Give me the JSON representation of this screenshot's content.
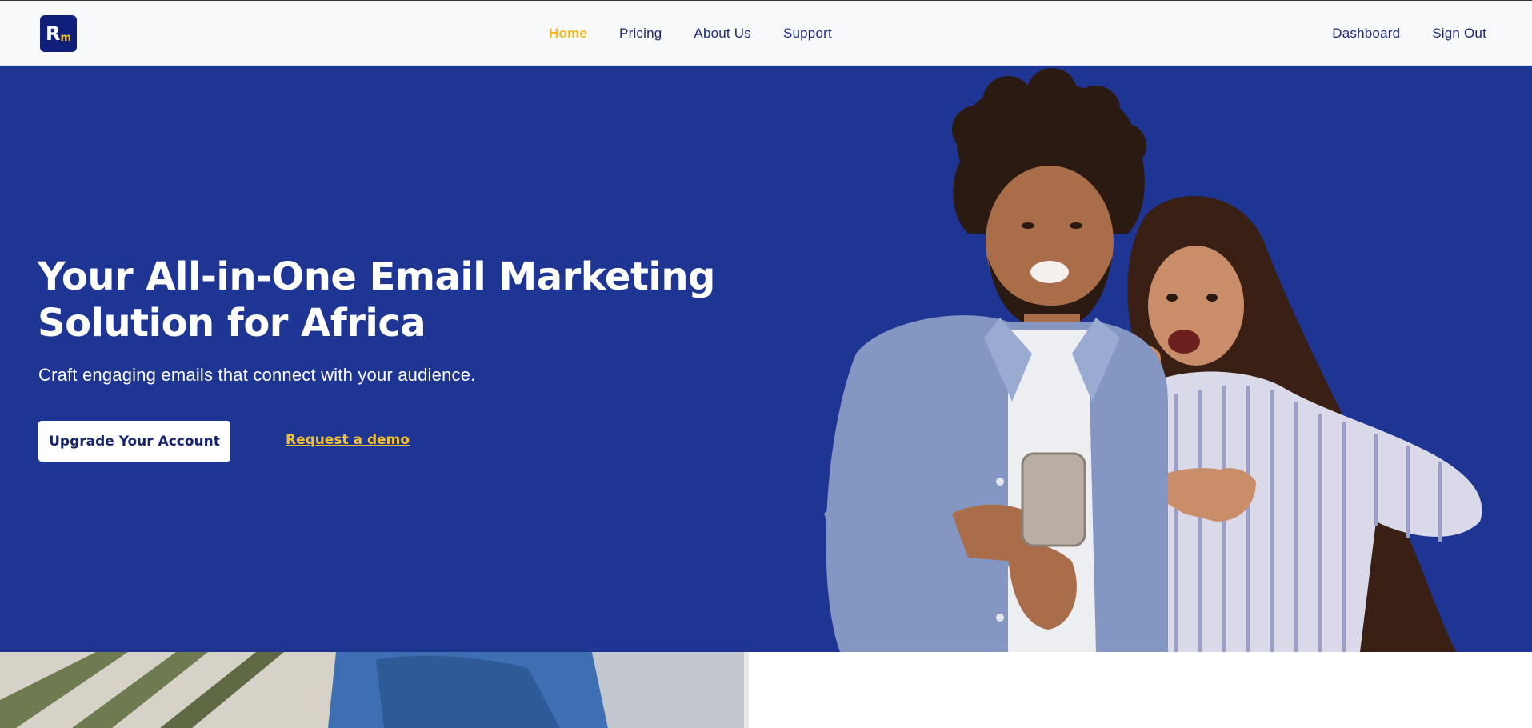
{
  "nav": {
    "logo_text_r": "R",
    "logo_text_m": "m",
    "links": [
      {
        "label": "Home",
        "active": true
      },
      {
        "label": "Pricing",
        "active": false
      },
      {
        "label": "About Us",
        "active": false
      },
      {
        "label": "Support",
        "active": false
      }
    ],
    "right_links": [
      {
        "label": "Dashboard"
      },
      {
        "label": "Sign Out"
      }
    ]
  },
  "hero": {
    "title_line1": "Your All-in-One Email Marketing",
    "title_line2": "Solution for Africa",
    "subtitle": "Craft engaging emails that connect with your audience.",
    "cta_primary": "Upgrade Your Account",
    "cta_secondary": "Request a demo"
  },
  "colors": {
    "brand_blue": "#1e3594",
    "logo_bg": "#0f1f7a",
    "accent_yellow": "#f5b921",
    "nav_text": "#1c2a7a",
    "nav_bg": "#f8f9fb"
  }
}
